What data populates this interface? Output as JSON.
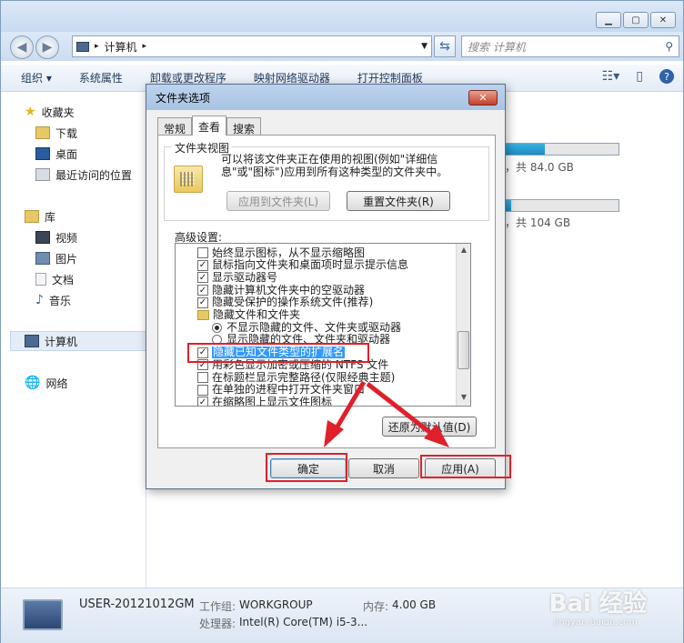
{
  "explorer": {
    "address_path": "计算机",
    "search_placeholder": "搜索 计算机",
    "toolbar": {
      "organize": "组织 ▾",
      "system_properties": "系统属性",
      "uninstall": "卸载或更改程序",
      "map_drive": "映射网络驱动器",
      "control_panel": "打开控制面板"
    },
    "sidebar": {
      "favorites": "收藏夹",
      "downloads": "下载",
      "desktop": "桌面",
      "recent": "最近访问的位置",
      "libraries": "库",
      "videos": "视频",
      "pictures": "图片",
      "documents": "文档",
      "music": "音乐",
      "computer": "计算机",
      "network": "网络"
    },
    "drives": [
      {
        "free_text": "，共 84.0 GB",
        "usage": 0.35
      },
      {
        "free_text": "，共 104 GB",
        "usage": 0.05
      }
    ],
    "status": {
      "computer_name": "USER-20121012GM",
      "workgroup_label": "工作组:",
      "workgroup_value": "WORKGROUP",
      "memory_label": "内存:",
      "memory_value": "4.00 GB",
      "cpu_label": "处理器:",
      "cpu_value": "Intel(R) Core(TM) i5-3..."
    },
    "watermark": "Bai 经验",
    "watermark_url": "jingyan.baidu.com"
  },
  "dialog": {
    "title": "文件夹选项",
    "close": "✕",
    "tabs": [
      "常规",
      "查看",
      "搜索"
    ],
    "folder_view": {
      "label": "文件夹视图",
      "description": "可以将该文件夹正在使用的视图(例如\"详细信息\"或\"图标\")应用到所有这种类型的文件夹中。",
      "apply_button": "应用到文件夹(L)",
      "reset_button": "重置文件夹(R)"
    },
    "advanced_label": "高级设置:",
    "advanced_items": [
      {
        "kind": "checkbox",
        "checked": false,
        "text": "始终显示图标，从不显示缩略图"
      },
      {
        "kind": "checkbox",
        "checked": true,
        "text": "鼠标指向文件夹和桌面项时显示提示信息"
      },
      {
        "kind": "checkbox",
        "checked": true,
        "text": "显示驱动器号"
      },
      {
        "kind": "checkbox",
        "checked": true,
        "text": "隐藏计算机文件夹中的空驱动器"
      },
      {
        "kind": "checkbox",
        "checked": true,
        "text": "隐藏受保护的操作系统文件(推荐)"
      },
      {
        "kind": "folder",
        "text": "隐藏文件和文件夹"
      },
      {
        "kind": "radio",
        "checked": true,
        "text": "不显示隐藏的文件、文件夹或驱动器"
      },
      {
        "kind": "radio",
        "checked": false,
        "text": "显示隐藏的文件、文件夹和驱动器"
      },
      {
        "kind": "checkbox",
        "checked": true,
        "text": "隐藏已知文件类型的扩展名",
        "selected": true
      },
      {
        "kind": "checkbox",
        "checked": true,
        "text": "用彩色显示加密或压缩的 NTFS 文件"
      },
      {
        "kind": "checkbox",
        "checked": false,
        "text": "在标题栏显示完整路径(仅限经典主题)"
      },
      {
        "kind": "checkbox",
        "checked": false,
        "text": "在单独的进程中打开文件夹窗口"
      },
      {
        "kind": "checkbox",
        "checked": true,
        "text": "在缩略图上显示文件图标"
      }
    ],
    "restore_button": "还原为默认值(D)",
    "ok_button": "确定",
    "cancel_button": "取消",
    "apply_button": "应用(A)"
  },
  "colors": {
    "annotation": "#e0202a",
    "selection": "#3399ff"
  }
}
